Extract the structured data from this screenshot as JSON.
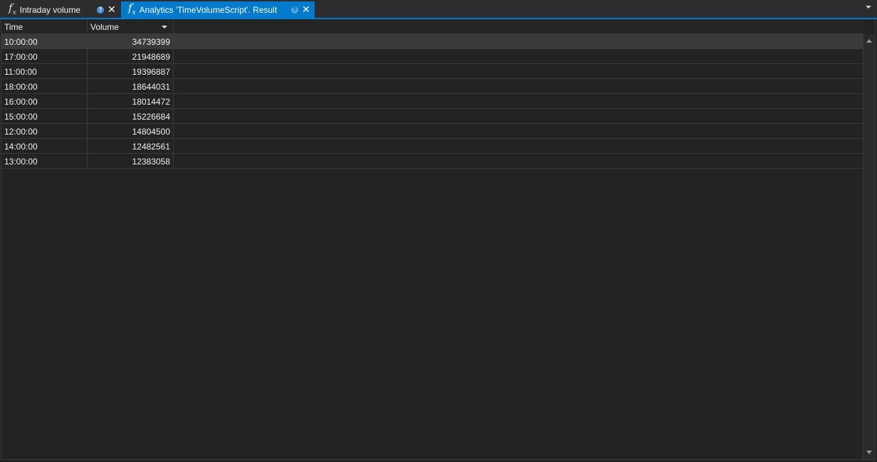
{
  "tabs": [
    {
      "icon": "function-icon",
      "title": "Intraday volume",
      "active": false
    },
    {
      "icon": "function-icon",
      "title": "Analytics 'TimeVolumeScript'. Result",
      "active": true
    }
  ],
  "icons": {
    "fx_main": "f",
    "fx_sub": "x",
    "help": "?",
    "close": "✕"
  },
  "grid": {
    "columns": [
      {
        "label": "Time"
      },
      {
        "label": "Volume",
        "sorted": "descending"
      }
    ],
    "rows": [
      {
        "time": "10:00:00",
        "volume": "34739399"
      },
      {
        "time": "17:00:00",
        "volume": "21948689"
      },
      {
        "time": "11:00:00",
        "volume": "19396887"
      },
      {
        "time": "18:00:00",
        "volume": "18644031"
      },
      {
        "time": "16:00:00",
        "volume": "18014472"
      },
      {
        "time": "15:00:00",
        "volume": "15226684"
      },
      {
        "time": "12:00:00",
        "volume": "14804500"
      },
      {
        "time": "14:00:00",
        "volume": "12482561"
      },
      {
        "time": "13:00:00",
        "volume": "12383058"
      }
    ],
    "selected_row": 0
  },
  "colors": {
    "accent": "#007acc",
    "background": "#232323",
    "selected_row": "#3a3a3a"
  }
}
